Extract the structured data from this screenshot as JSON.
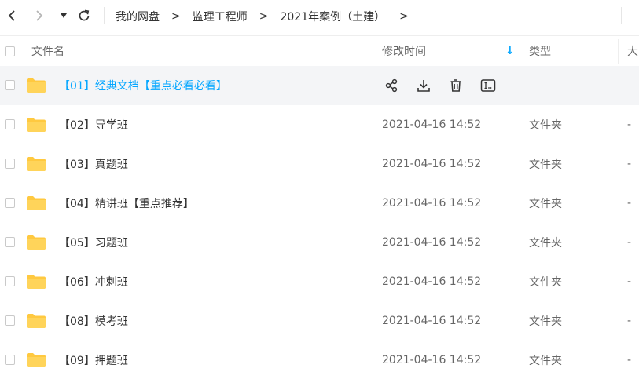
{
  "toolbar": {
    "back_icon": "chevron-left-icon",
    "forward_icon": "chevron-right-icon",
    "dropdown_icon": "caret-down-icon",
    "refresh_icon": "refresh-icon"
  },
  "breadcrumb": {
    "items": [
      "我的网盘",
      "监理工程师",
      "2021年案例（土建）"
    ],
    "separator": ">"
  },
  "columns": {
    "name": "文件名",
    "modified": "修改时间",
    "type": "类型",
    "size": "大"
  },
  "sort_indicator": "↓",
  "colors": {
    "accent": "#06a7ff",
    "folder": "#ffc940",
    "hover_row": "#f4f5f7"
  },
  "rows": [
    {
      "name": "【01】经典文档【重点必看必看】",
      "date": "",
      "type": "",
      "size": ""
    },
    {
      "name": "【02】导学班",
      "date": "2021-04-16 14:52",
      "type": "文件夹",
      "size": "-"
    },
    {
      "name": "【03】真题班",
      "date": "2021-04-16 14:52",
      "type": "文件夹",
      "size": "-"
    },
    {
      "name": "【04】精讲班【重点推荐】",
      "date": "2021-04-16 14:52",
      "type": "文件夹",
      "size": "-"
    },
    {
      "name": "【05】习题班",
      "date": "2021-04-16 14:52",
      "type": "文件夹",
      "size": "-"
    },
    {
      "name": "【06】冲刺班",
      "date": "2021-04-16 14:52",
      "type": "文件夹",
      "size": "-"
    },
    {
      "name": "【08】模考班",
      "date": "2021-04-16 14:52",
      "type": "文件夹",
      "size": "-"
    },
    {
      "name": "【09】押题班",
      "date": "2021-04-16 14:52",
      "type": "文件夹",
      "size": "-"
    }
  ],
  "row_actions": [
    "share-icon",
    "download-icon",
    "delete-icon",
    "rename-icon"
  ]
}
